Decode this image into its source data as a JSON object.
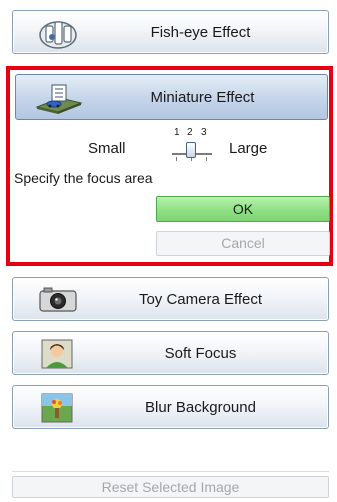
{
  "effects": {
    "fisheye": {
      "label": "Fish-eye Effect",
      "icon": "fish-eye-icon"
    },
    "miniature": {
      "label": "Miniature Effect",
      "icon": "miniature-icon"
    },
    "toy_camera": {
      "label": "Toy Camera Effect",
      "icon": "toy-camera-icon"
    },
    "soft_focus": {
      "label": "Soft Focus",
      "icon": "soft-focus-icon"
    },
    "blur_background": {
      "label": "Blur Background",
      "icon": "blur-background-icon"
    }
  },
  "miniature_settings": {
    "size_small_label": "Small",
    "size_large_label": "Large",
    "ticks": [
      "1",
      "2",
      "3"
    ],
    "selected_level": 2,
    "focus_label": "Specify the focus area"
  },
  "buttons": {
    "ok": "OK",
    "cancel": "Cancel",
    "reset": "Reset Selected Image"
  },
  "colors": {
    "highlight_border": "#e60012",
    "ok_button": "#8fe084",
    "selected_button": "#c7d6ea"
  }
}
